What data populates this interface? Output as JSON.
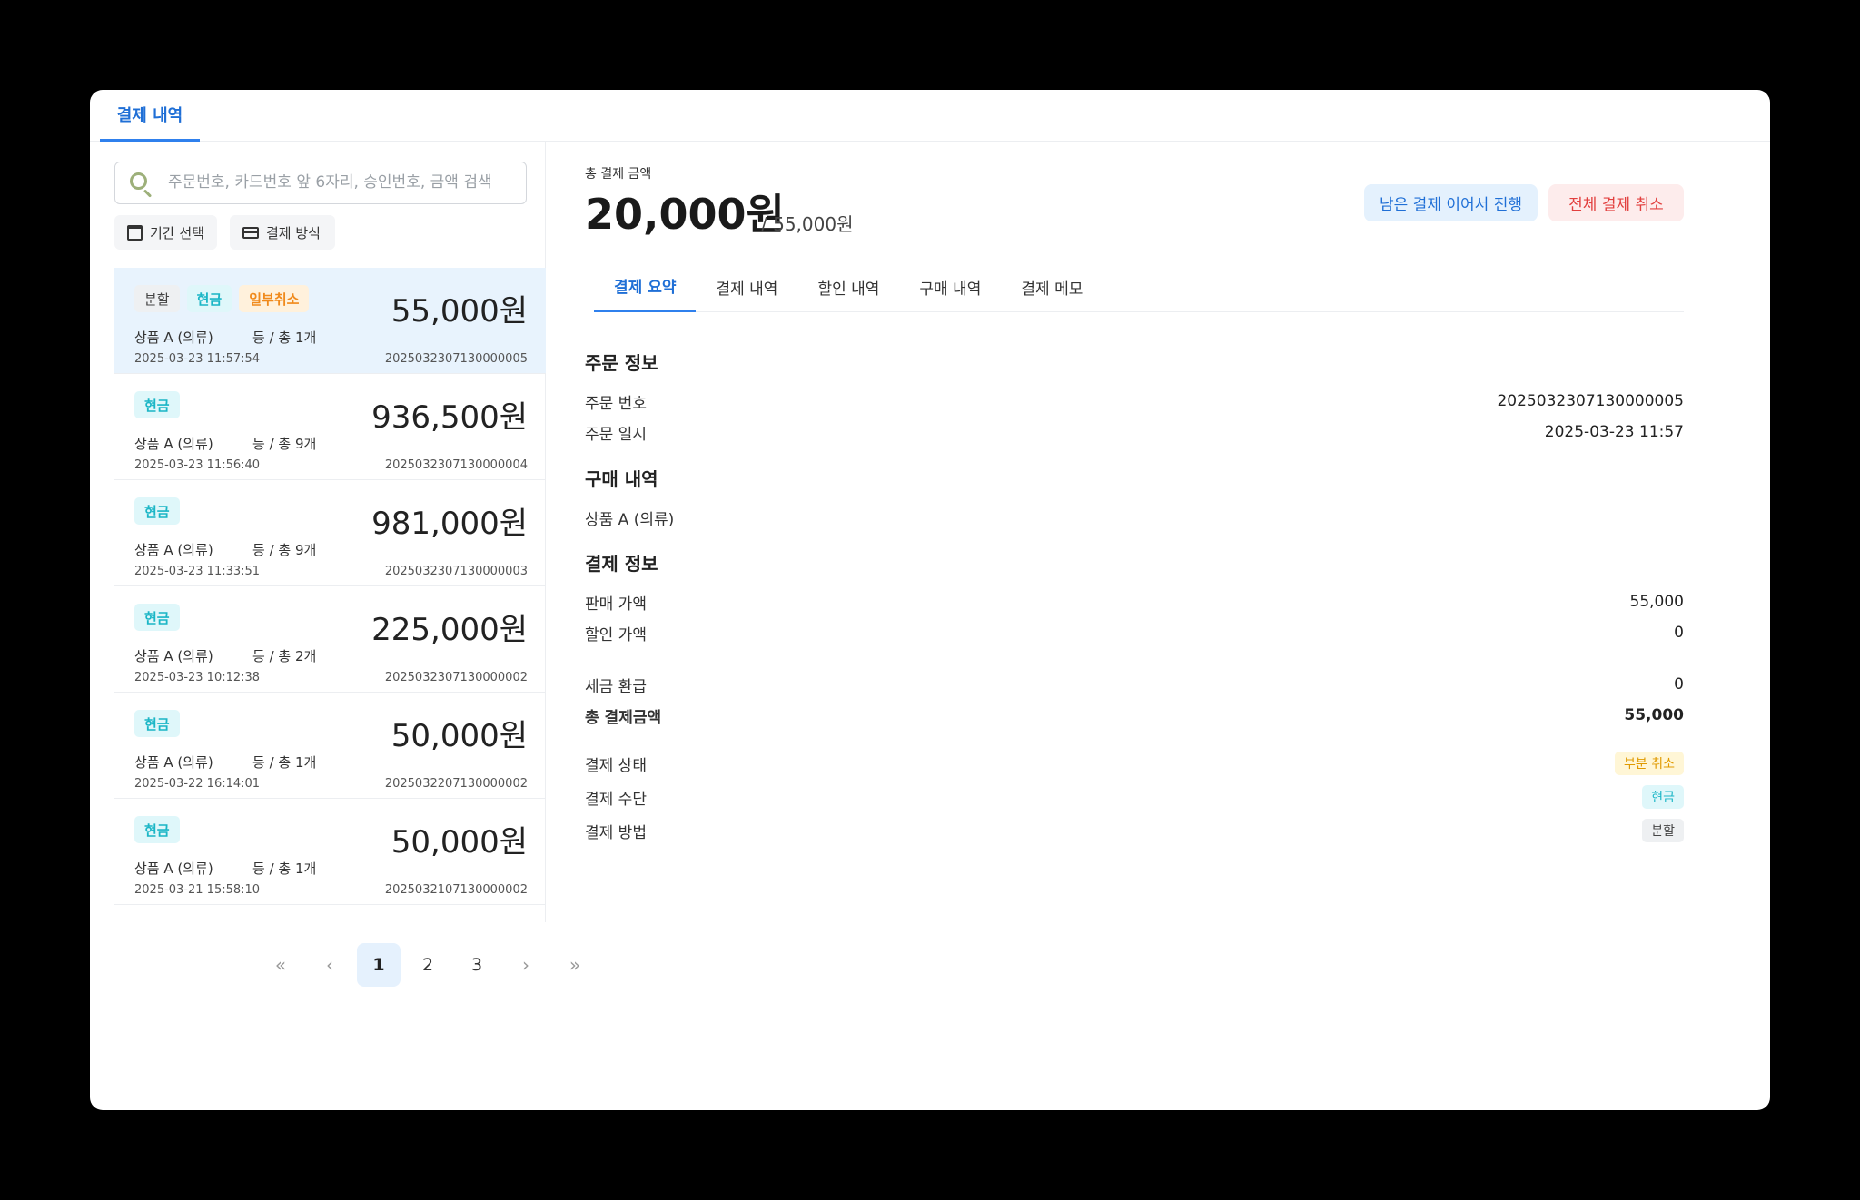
{
  "header": {
    "tab_label": "결제 내역"
  },
  "search": {
    "placeholder": "주문번호, 카드번호 앞 6자리, 승인번호, 금액 검색"
  },
  "filters": {
    "date_label": "기간 선택",
    "method_label": "결제 방식"
  },
  "orders": [
    {
      "badges": [
        "분할",
        "현금",
        "일부취소"
      ],
      "amount": "55,000원",
      "product": "상품 A (의류)",
      "grade": "등  /  총 1개",
      "time": "2025-03-23 11:57:54",
      "id": "2025032307130000005"
    },
    {
      "badges": [
        "현금"
      ],
      "amount": "936,500원",
      "product": "상품 A (의류)",
      "grade": "등  /  총 9개",
      "time": "2025-03-23 11:56:40",
      "id": "2025032307130000004"
    },
    {
      "badges": [
        "현금"
      ],
      "amount": "981,000원",
      "product": "상품 A (의류)",
      "grade": "등  /  총 9개",
      "time": "2025-03-23 11:33:51",
      "id": "2025032307130000003"
    },
    {
      "badges": [
        "현금"
      ],
      "amount": "225,000원",
      "product": "상품 A (의류)",
      "grade": "등  /  총 2개",
      "time": "2025-03-23 10:12:38",
      "id": "2025032307130000002"
    },
    {
      "badges": [
        "현금"
      ],
      "amount": "50,000원",
      "product": "상품 A (의류)",
      "grade": "등  /  총 1개",
      "time": "2025-03-22 16:14:01",
      "id": "2025032207130000002"
    },
    {
      "badges": [
        "현금"
      ],
      "amount": "50,000원",
      "product": "상품 A (의류)",
      "grade": "등  /  총 1개",
      "time": "2025-03-21 15:58:10",
      "id": "2025032107130000002"
    }
  ],
  "pagination": {
    "first": "«",
    "prev": "‹",
    "pages": [
      "1",
      "2",
      "3"
    ],
    "current": "1",
    "next": "›",
    "last": "»"
  },
  "detail": {
    "total_label": "총 결제 금액",
    "total_amount": "20,000원",
    "total_sub": "/  55,000원",
    "continue_label": "남은 결제 이어서 진행",
    "cancel_label": "전체 결제 취소",
    "tabs": [
      "결제 요약",
      "결제 내역",
      "할인 내역",
      "구매 내역",
      "결제 메모"
    ],
    "active_tab": "결제 요약",
    "order_info_title": "주문 정보",
    "order_no_label": "주문 번호",
    "order_no": "2025032307130000005",
    "order_date_label": "주문 일시",
    "order_date": "2025-03-23 11:57",
    "purchase_title": "구매 내역",
    "purchase_item": "상품 A (의류)",
    "payment_info_title": "결제 정보",
    "sale_price_label": "판매 가액",
    "sale_price": "55,000",
    "discount_label": "할인 가액",
    "discount": "0",
    "tax_refund_label": "세금 환급",
    "tax_refund": "0",
    "total_paid_label": "총 결제금액",
    "total_paid": "55,000",
    "status_label": "결제 상태",
    "status": "부분 취소",
    "means_label": "결제 수단",
    "means": "현금",
    "method_label": "결제 방법",
    "method": "분할"
  }
}
